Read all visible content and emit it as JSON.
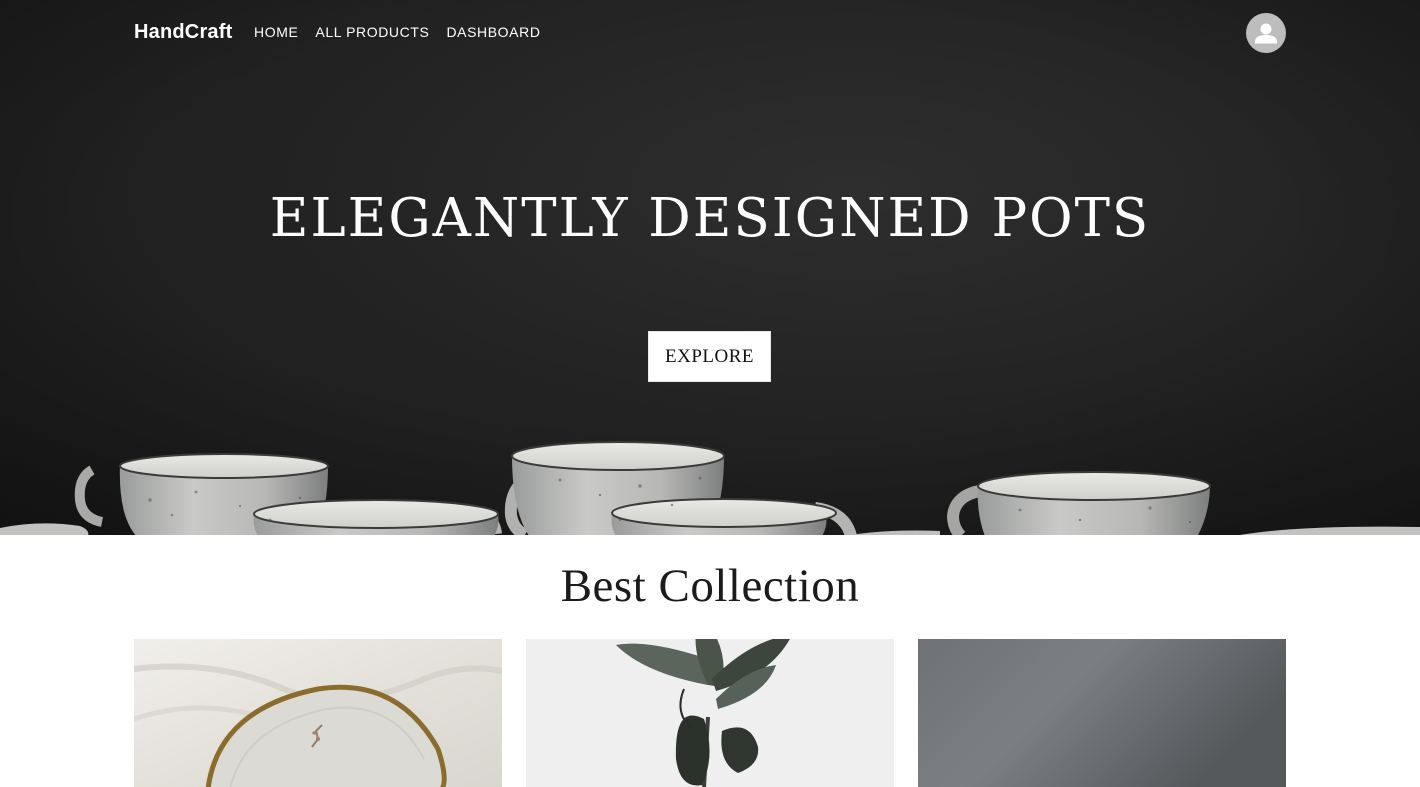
{
  "navbar": {
    "brand": "HandCraft",
    "links": [
      {
        "label": "HOME"
      },
      {
        "label": "ALL PRODUCTS"
      },
      {
        "label": "DASHBOARD"
      }
    ],
    "avatar_icon": "account-circle-icon"
  },
  "hero": {
    "title": "ELEGANTLY DESIGNED POTS",
    "button_label": "EXPLORE"
  },
  "collection": {
    "title": "Best Collection",
    "cards": [
      {
        "image": "ceramic-plate-with-gold-rim"
      },
      {
        "image": "rubber-plant-leaves"
      },
      {
        "image": "grey-gradient-backdrop"
      }
    ]
  },
  "colors": {
    "hero_background": "#232323",
    "text_light": "#ffffff",
    "avatar_bg": "#bdbdbd"
  }
}
